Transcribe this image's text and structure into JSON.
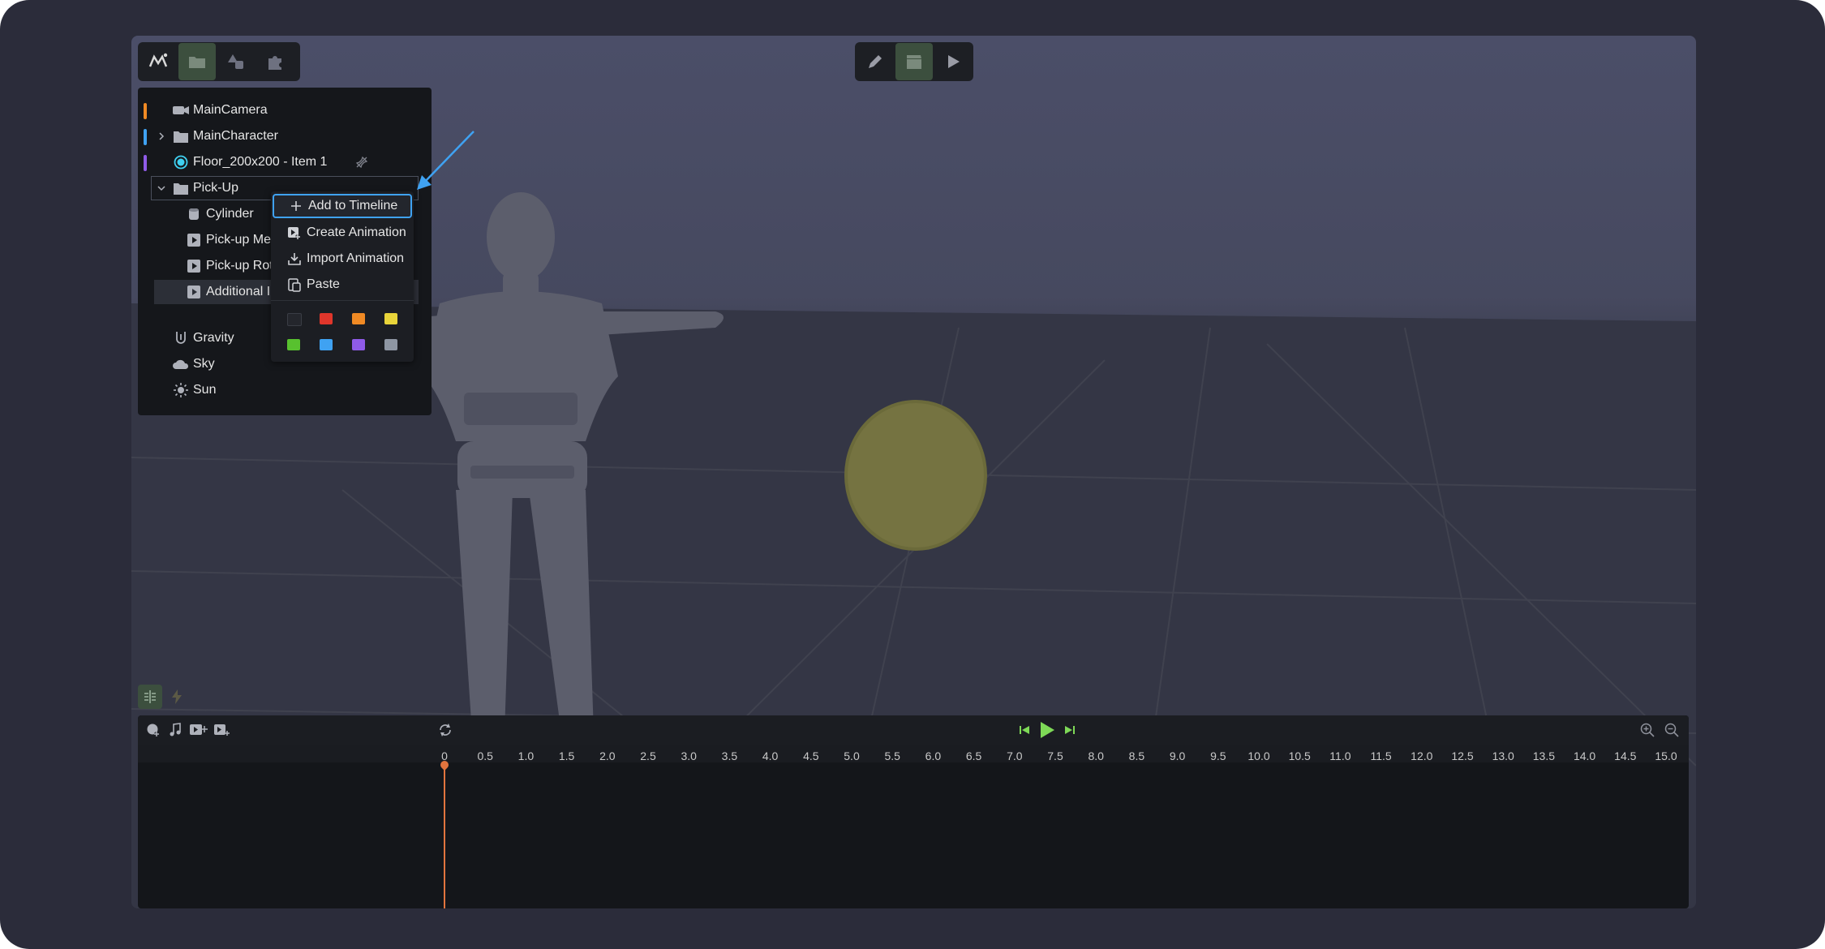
{
  "app": {
    "toolbar_left": {
      "icons": [
        "logo-icon",
        "folder-icon",
        "shapes-icon",
        "puzzle-icon"
      ],
      "active": "folder-icon"
    },
    "toolbar_center": {
      "icons": [
        "pencil-icon",
        "clapperboard-icon",
        "play-icon"
      ],
      "active": "clapperboard-icon"
    }
  },
  "scene_tree": {
    "items": [
      {
        "label": "MainCamera",
        "icon": "camera-icon",
        "color": "#f08a24"
      },
      {
        "label": "MainCharacter",
        "icon": "folder-icon",
        "color": "#3fa2f2",
        "expandable": true
      },
      {
        "label": "Floor_200x200 - Item 1",
        "icon": "target-icon",
        "color": "#8f5be8",
        "pin_icon": "pin-off-icon"
      },
      {
        "label": "Pick-Up",
        "icon": "folder-icon",
        "expanded": true
      },
      {
        "label": "Cylinder",
        "icon": "cylinder-icon"
      },
      {
        "label": "Pick-up Me",
        "icon": "animation-icon"
      },
      {
        "label": "Pick-up Rot",
        "icon": "animation-icon"
      },
      {
        "label": "Additional I",
        "icon": "animation-icon"
      },
      {
        "label": "Gravity",
        "icon": "gravity-icon"
      },
      {
        "label": "Sky",
        "icon": "cloud-icon"
      },
      {
        "label": "Sun",
        "icon": "sun-icon"
      }
    ]
  },
  "context_menu": {
    "items": [
      {
        "label": "Add to Timeline",
        "icon": "plus-icon",
        "focused": true
      },
      {
        "label": "Create Animation",
        "icon": "create-animation-icon"
      },
      {
        "label": "Import Animation",
        "icon": "import-icon"
      },
      {
        "label": "Paste",
        "icon": "paste-icon"
      }
    ],
    "colors": [
      "#24262c",
      "#e0362b",
      "#f08a24",
      "#e8d43a",
      "#58c12f",
      "#3fa2f2",
      "#8f5be8",
      "#8e96a3"
    ]
  },
  "timeline": {
    "toolbar_icons": [
      "add-object-icon",
      "music-icon",
      "add-clip-icon",
      "add-video-icon",
      "loop-icon",
      "skip-back-icon",
      "play-icon",
      "skip-forward-icon",
      "zoom-in-icon",
      "zoom-out-icon"
    ],
    "ticks": [
      "0",
      "0.5",
      "1.0",
      "1.5",
      "2.0",
      "2.5",
      "3.0",
      "3.5",
      "4.0",
      "4.5",
      "5.0",
      "5.5",
      "6.0",
      "6.5",
      "7.0",
      "7.5",
      "8.0",
      "8.5",
      "9.0",
      "9.5",
      "10.0",
      "10.5",
      "11.0",
      "11.5",
      "12.0",
      "12.5",
      "13.0",
      "13.5",
      "14.0",
      "14.5",
      "15.0"
    ],
    "playhead_value": "0"
  },
  "colors": {
    "accent": "#3fa2f2",
    "playhead": "#e2743e",
    "active_green": "#3c4f3e",
    "play_green": "#7ed957"
  }
}
